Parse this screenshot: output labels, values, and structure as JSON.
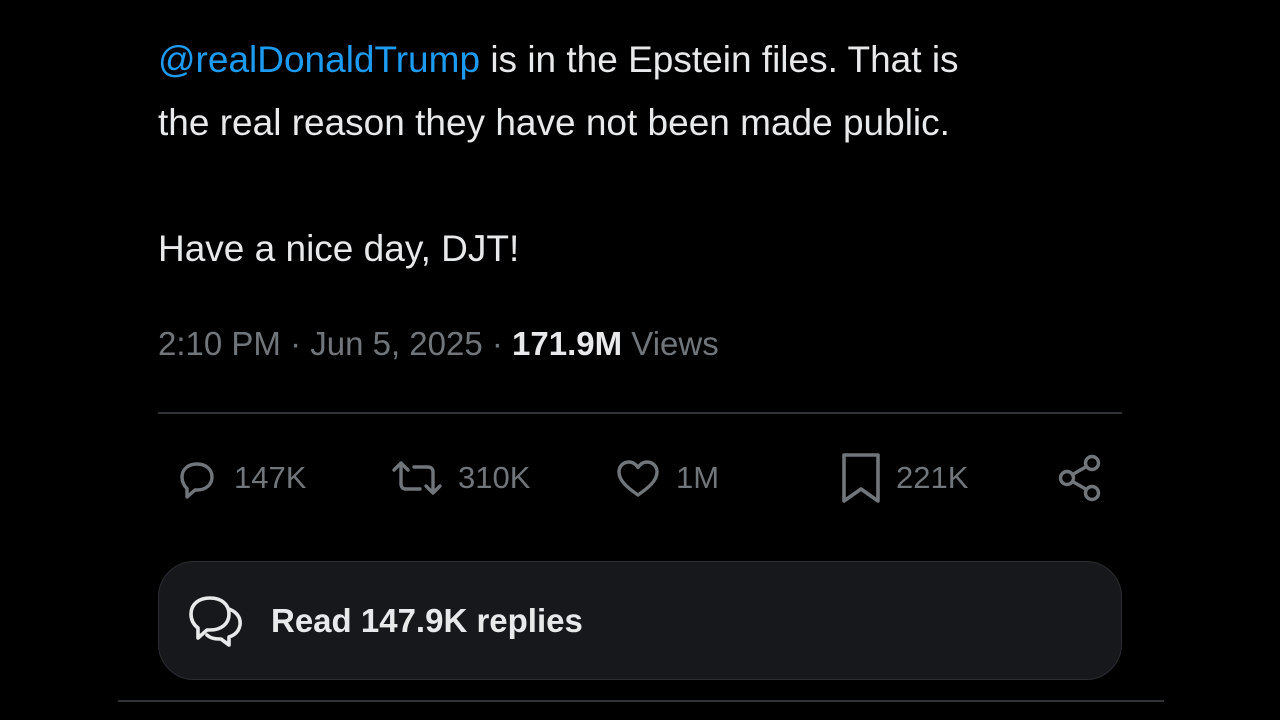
{
  "tweet": {
    "mention": "@realDonaldTrump",
    "line1_rest": " is in the Epstein files. That is",
    "line2": "the real reason they have not been made public.",
    "line3": "Have a nice day, DJT!"
  },
  "meta": {
    "time": "2:10 PM",
    "separator1": " · ",
    "date": "Jun 5, 2025",
    "separator2": " · ",
    "views_count": "171.9M",
    "views_label": " Views"
  },
  "actions": {
    "replies": "147K",
    "reposts": "310K",
    "likes": "1M",
    "bookmarks": "221K"
  },
  "read_replies": {
    "label": "Read 147.9K replies"
  },
  "colors": {
    "background": "#000000",
    "text": "#e7e9ea",
    "muted": "#71767b",
    "accent": "#1d9bf0"
  },
  "icons": [
    "reply-icon",
    "repost-icon",
    "like-icon",
    "bookmark-icon",
    "share-icon",
    "replies-bubbles-icon"
  ]
}
